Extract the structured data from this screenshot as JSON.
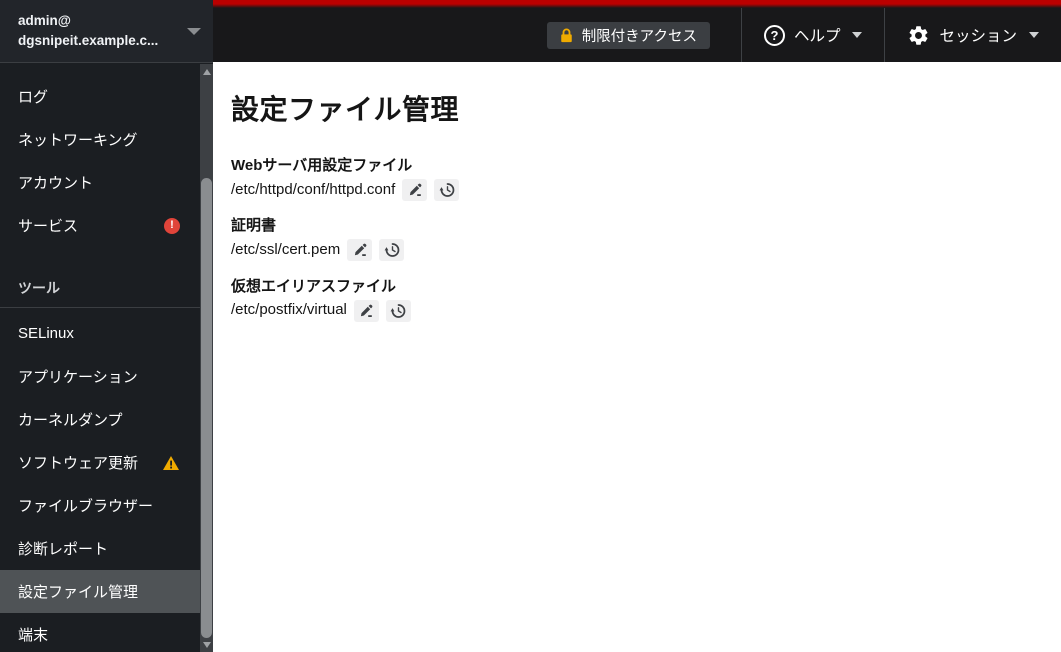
{
  "colors": {
    "stripe_red": "#bb0000",
    "masthead_bg": "#18181a",
    "sidebar_bg": "#1b1e22",
    "sidebar_header_bg": "#22252a",
    "separator": "#3b3e42",
    "selected_bg": "#4f5356",
    "scroll_track": "#3d4044",
    "badge_error": "#e0443a",
    "badge_warning": "#f0ab00",
    "lock_gold": "#f0ab00"
  },
  "icons": {
    "user_caret": "caret-down",
    "lock": "lock-icon",
    "help_glyph": "?",
    "error_glyph": "!",
    "warning_glyph": "!",
    "gear": "gear-icon",
    "pencil": "pencil-icon",
    "history": "history-icon"
  },
  "masthead": {
    "restricted_label": "制限付きアクセス",
    "help_label": "ヘルプ",
    "session_label": "セッション"
  },
  "sidebar": {
    "user": {
      "name": "admin@",
      "host": "dgsnipeit.example.c..."
    },
    "nav_top": [
      {
        "label": "ログ"
      },
      {
        "label": "ネットワーキング"
      },
      {
        "label": "アカウント"
      },
      {
        "label": "サービス",
        "badge": "error"
      }
    ],
    "section_label": "ツール",
    "nav_tools": [
      {
        "label": "SELinux"
      },
      {
        "label": "アプリケーション"
      },
      {
        "label": "カーネルダンプ"
      },
      {
        "label": "ソフトウェア更新",
        "badge": "warning"
      },
      {
        "label": "ファイルブラウザー"
      },
      {
        "label": "診断レポート"
      },
      {
        "label": "設定ファイル管理",
        "selected": true
      },
      {
        "label": "端末"
      }
    ]
  },
  "main": {
    "title": "設定ファイル管理",
    "files": [
      {
        "label": "Webサーバ用設定ファイル",
        "path": "/etc/httpd/conf/httpd.conf"
      },
      {
        "label": "証明書",
        "path": "/etc/ssl/cert.pem"
      },
      {
        "label": "仮想エイリアスファイル",
        "path": "/etc/postfix/virtual"
      }
    ]
  }
}
